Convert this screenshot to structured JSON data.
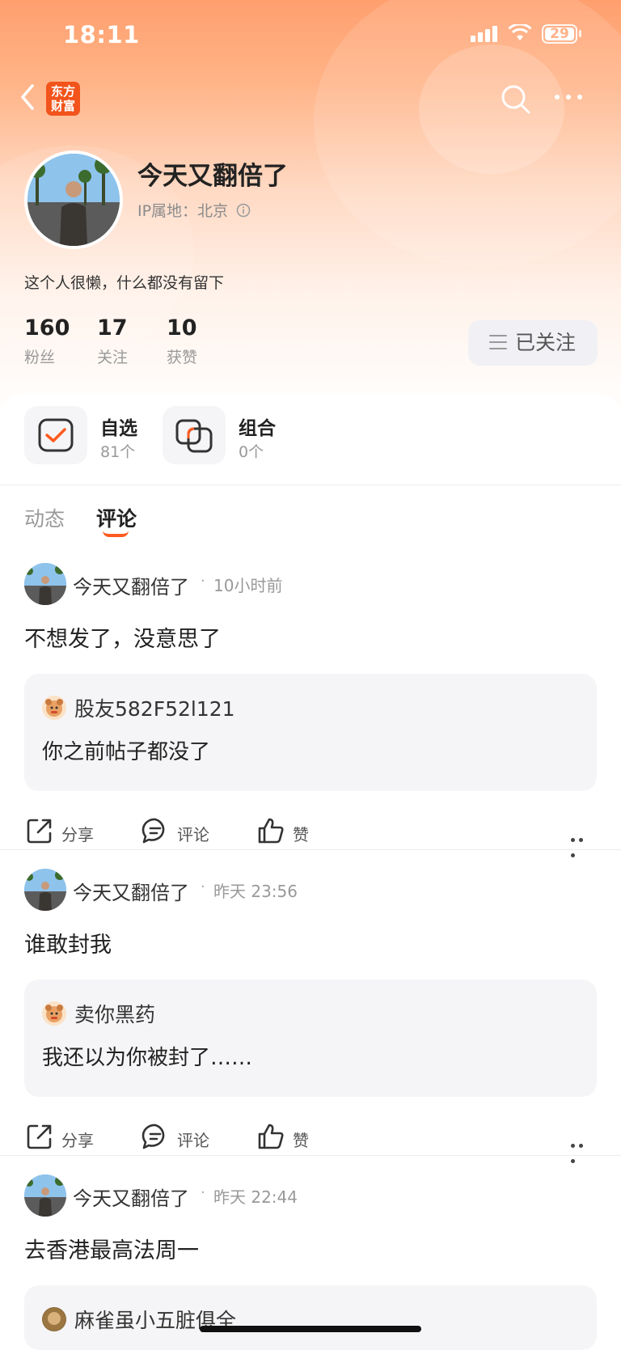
{
  "status_bar": {
    "time": "18:11",
    "battery": "29"
  },
  "nav": {
    "logo_line1": "东方",
    "logo_line2": "财富"
  },
  "profile": {
    "name": "今天又翻倍了",
    "ip_location": "IP属地：北京",
    "bio": "这个人很懒，什么都没有留下",
    "stats": [
      {
        "value": "160",
        "label": "粉丝"
      },
      {
        "value": "17",
        "label": "关注"
      },
      {
        "value": "10",
        "label": "获赞"
      }
    ],
    "follow_label": "已关注"
  },
  "quick_links": [
    {
      "title": "自选",
      "sub": "81个"
    },
    {
      "title": "组合",
      "sub": "0个"
    }
  ],
  "tabs": [
    {
      "label": "动态",
      "active": false
    },
    {
      "label": "评论",
      "active": true
    }
  ],
  "action_labels": {
    "share": "分享",
    "comment": "评论",
    "like": "赞"
  },
  "posts": [
    {
      "author": "今天又翻倍了",
      "time": "10小时前",
      "text": "不想发了，没意思了",
      "quote_author": "股友582F52l121",
      "quote_text": "你之前帖子都没了"
    },
    {
      "author": "今天又翻倍了",
      "time": "昨天 23:56",
      "text": "谁敢封我",
      "quote_author": "卖你黑药",
      "quote_text": "我还以为你被封了……"
    },
    {
      "author": "今天又翻倍了",
      "time": "昨天 22:44",
      "text": "去香港最高法周一",
      "quote_author": "麻雀虽小五脏俱全",
      "quote_text": ""
    }
  ],
  "colors": {
    "accent": "#ff5a1f",
    "header_gradient_top": "#ff9f6e",
    "logo_bg": "#f2541b"
  }
}
